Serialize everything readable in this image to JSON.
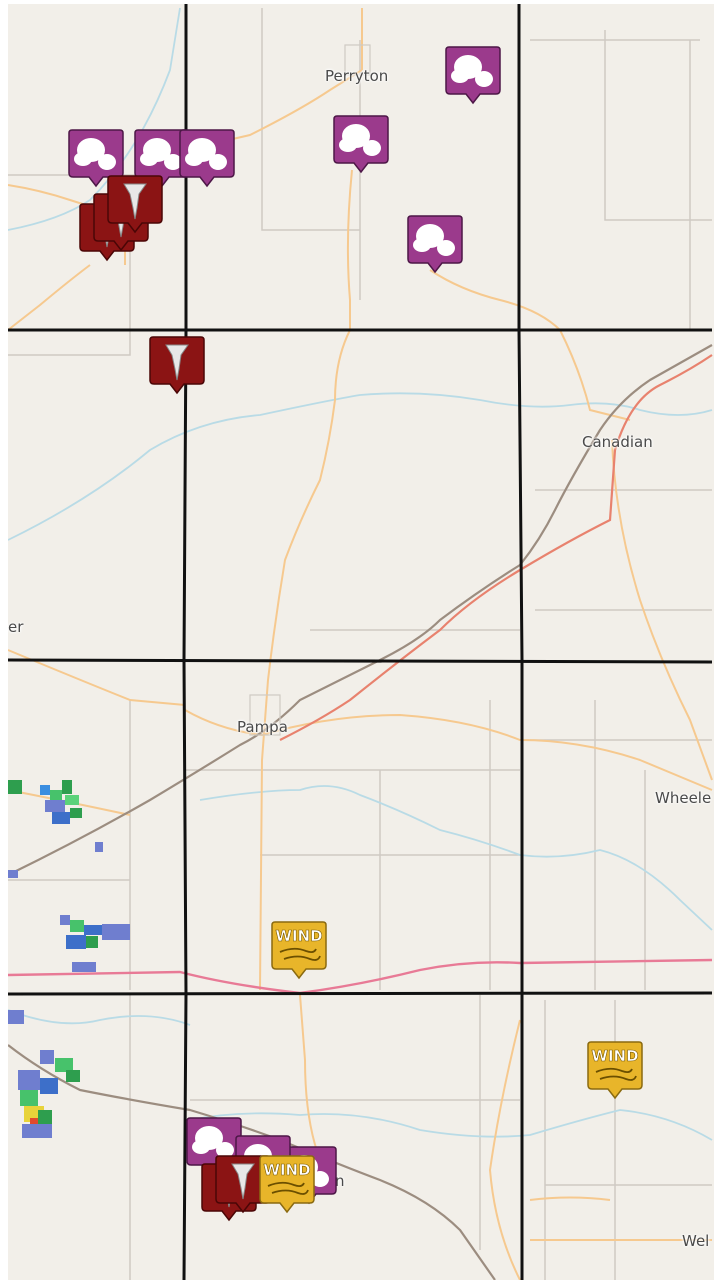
{
  "map": {
    "places": {
      "perryton": "Perryton",
      "canadian": "Canadian",
      "pampa": "Pampa",
      "wheeler": "Wheele",
      "wel": "Wel",
      "er": "er",
      "n": "n"
    },
    "markers": {
      "wind_label": "WIND",
      "hail_icon": "hail-cloud-icon",
      "tornado_icon": "tornado-icon",
      "wind_icon": "wind-swirl-icon"
    },
    "colors": {
      "hail_bg": "#9b3a8c",
      "tornado_bg": "#8b1414",
      "wind_bg": "#e8b52a",
      "county_line": "#111111",
      "road": "#f6c98f",
      "highway": "#e8826e",
      "river": "#b9dbe6",
      "rail": "#9c8d80"
    }
  }
}
